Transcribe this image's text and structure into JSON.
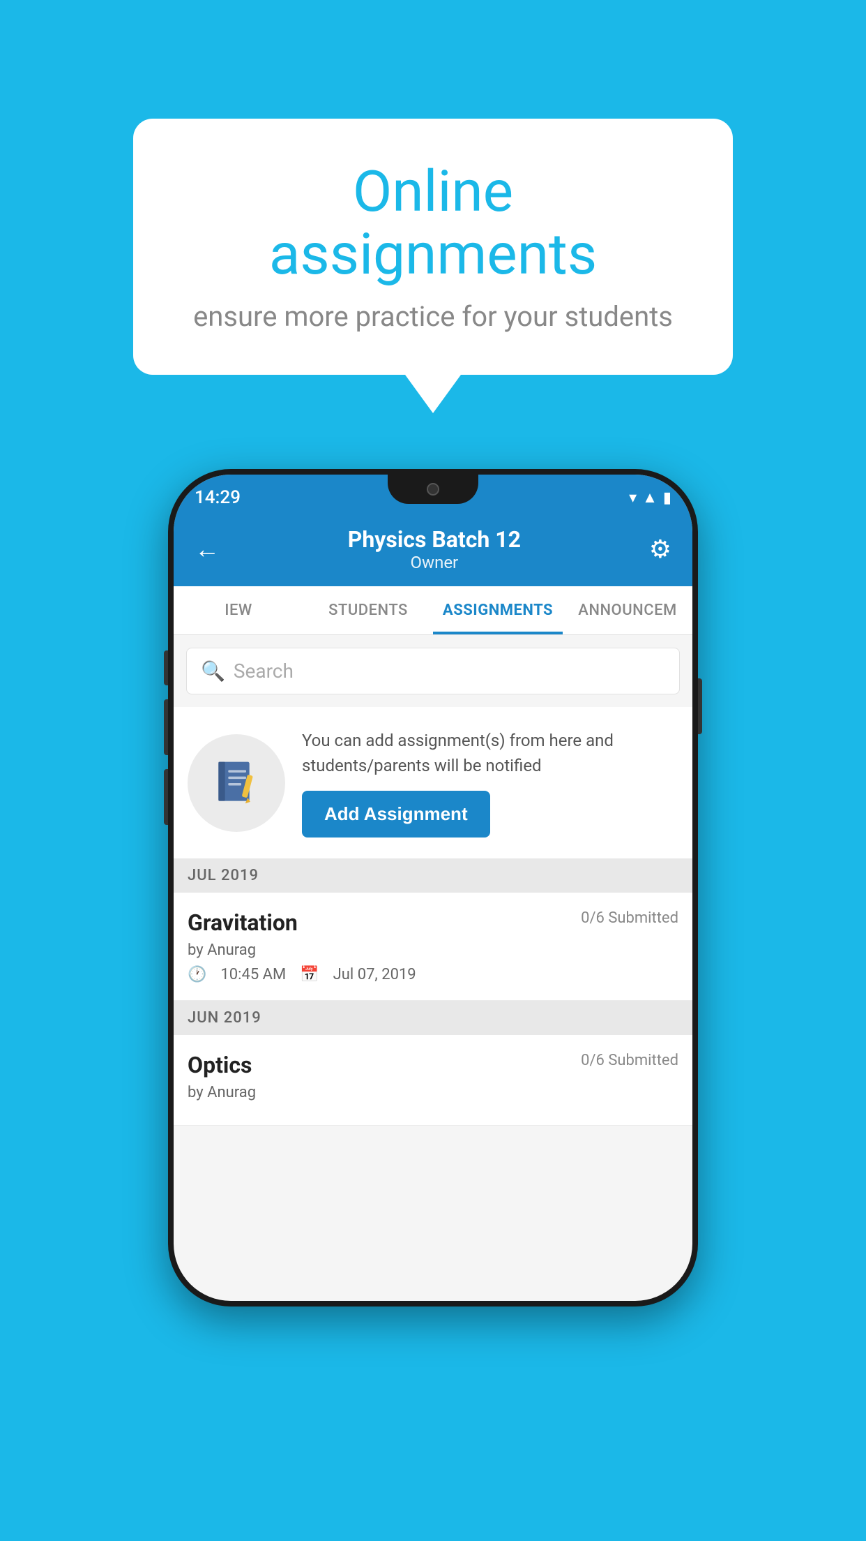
{
  "background": {
    "color": "#1BB8E8"
  },
  "speech_bubble": {
    "title": "Online assignments",
    "subtitle": "ensure more practice for your students"
  },
  "status_bar": {
    "time": "14:29",
    "icons": [
      "wifi",
      "signal",
      "battery"
    ]
  },
  "header": {
    "title": "Physics Batch 12",
    "subtitle": "Owner",
    "back_label": "←",
    "settings_label": "⚙"
  },
  "tabs": [
    {
      "label": "IEW",
      "active": false
    },
    {
      "label": "STUDENTS",
      "active": false
    },
    {
      "label": "ASSIGNMENTS",
      "active": true
    },
    {
      "label": "ANNOUNCEM",
      "active": false
    }
  ],
  "search": {
    "placeholder": "Search"
  },
  "add_assignment_section": {
    "description": "You can add assignment(s) from here and students/parents will be notified",
    "button_label": "Add Assignment"
  },
  "sections": [
    {
      "label": "JUL 2019",
      "assignments": [
        {
          "name": "Gravitation",
          "submitted": "0/6 Submitted",
          "by": "by Anurag",
          "time": "10:45 AM",
          "date": "Jul 07, 2019"
        }
      ]
    },
    {
      "label": "JUN 2019",
      "assignments": [
        {
          "name": "Optics",
          "submitted": "0/6 Submitted",
          "by": "by Anurag",
          "time": "",
          "date": ""
        }
      ]
    }
  ]
}
